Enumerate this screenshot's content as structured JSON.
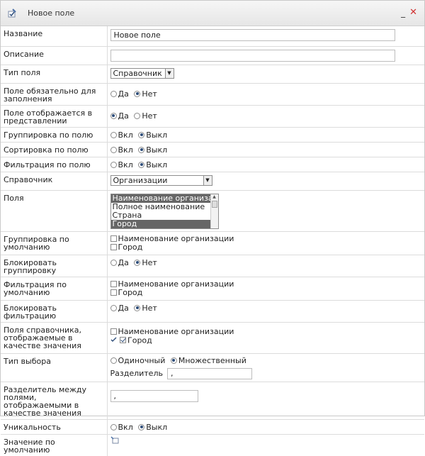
{
  "window": {
    "title": "Новое поле",
    "minimize": "_",
    "close": "✕"
  },
  "fields": {
    "name": {
      "label": "Название",
      "value": "Новое поле"
    },
    "description": {
      "label": "Описание",
      "value": ""
    },
    "type": {
      "label": "Тип поля",
      "selected": "Справочник"
    },
    "required": {
      "label": "Поле обязательно для заполнения",
      "yes": "Да",
      "no": "Нет",
      "selected": "no"
    },
    "visible": {
      "label": "Поле отображается в представлении",
      "yes": "Да",
      "no": "Нет",
      "selected": "yes"
    },
    "group_by": {
      "label": "Группировка по полю",
      "on": "Вкл",
      "off": "Выкл",
      "selected": "off"
    },
    "sort_by": {
      "label": "Сортировка по полю",
      "on": "Вкл",
      "off": "Выкл",
      "selected": "off"
    },
    "filter_by": {
      "label": "Фильтрация по полю",
      "on": "Вкл",
      "off": "Выкл",
      "selected": "off"
    },
    "directory": {
      "label": "Справочник",
      "selected": "Организации"
    },
    "columns": {
      "label": "Поля",
      "items": [
        {
          "text": "Наименование организации",
          "selected": true
        },
        {
          "text": "Полное наименование",
          "selected": false
        },
        {
          "text": "Страна",
          "selected": false
        },
        {
          "text": "Город",
          "selected": true
        }
      ]
    },
    "default_group": {
      "label": "Группировка по умолчанию",
      "options": [
        {
          "text": "Наименование организации",
          "checked": false
        },
        {
          "text": "Город",
          "checked": false
        }
      ]
    },
    "lock_group": {
      "label": "Блокировать группировку",
      "yes": "Да",
      "no": "Нет",
      "selected": "no"
    },
    "default_filter": {
      "label": "Фильтрация по умолчанию",
      "options": [
        {
          "text": "Наименование организации",
          "checked": false
        },
        {
          "text": "Город",
          "checked": false
        }
      ]
    },
    "lock_filter": {
      "label": "Блокировать фильтрацию",
      "yes": "Да",
      "no": "Нет",
      "selected": "no"
    },
    "display_fields": {
      "label": "Поля справочника, отображаемые в качестве значения",
      "options": [
        {
          "text": "Наименование организации",
          "checked": false
        },
        {
          "text": "Город",
          "checked": true
        }
      ]
    },
    "select_type": {
      "label": "Тип выбора",
      "single": "Одиночный",
      "multiple": "Множественный",
      "selected": "multiple",
      "separator_label": "Разделитель",
      "separator_value": ","
    },
    "display_separator": {
      "label": "Разделитель между полями, отображаемыми в качестве значения",
      "value": ","
    },
    "unique": {
      "label": "Уникальность",
      "on": "Вкл",
      "off": "Выкл",
      "selected": "off"
    },
    "default_value": {
      "label": "Значение по умолчанию"
    }
  },
  "colors": {
    "close": "#d03030",
    "list_selected": "#666666",
    "radio_dot": "#2d4d7a"
  }
}
